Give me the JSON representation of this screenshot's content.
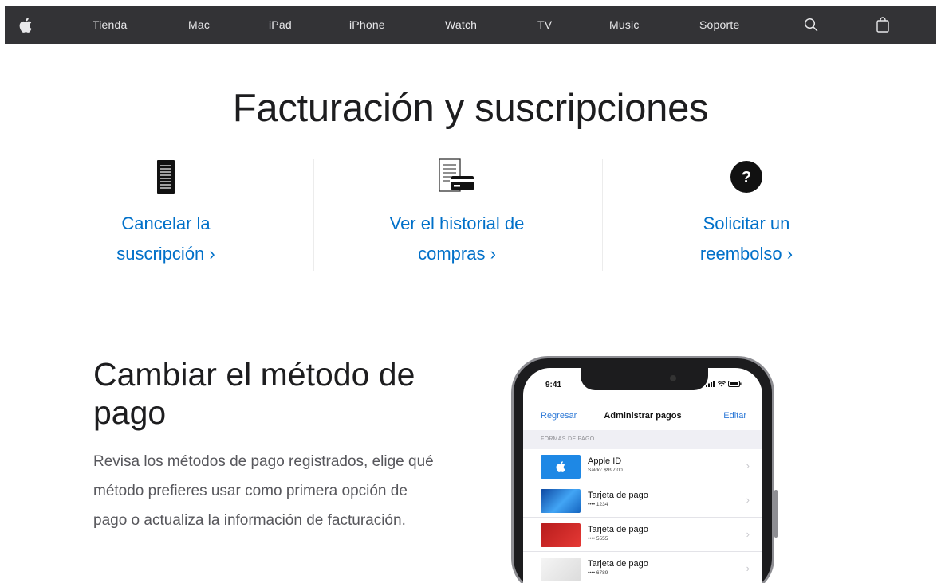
{
  "nav": {
    "items": [
      "Tienda",
      "Mac",
      "iPad",
      "iPhone",
      "Watch",
      "TV",
      "Music",
      "Soporte"
    ],
    "icons": [
      "apple-logo",
      "search-icon",
      "bag-icon"
    ]
  },
  "hero": {
    "title": "Facturación y suscripciones"
  },
  "links": [
    {
      "line1": "Cancelar la",
      "line2": "suscripción ›",
      "icon": "document-icon"
    },
    {
      "line1": "Ver el historial de",
      "line2": "compras ›",
      "icon": "receipt-card-icon"
    },
    {
      "line1": "Solicitar un",
      "line2": "reembolso ›",
      "icon": "question-circle-icon"
    }
  ],
  "section": {
    "title": "Cambiar el método de pago",
    "body": "Revisa los métodos de pago registrados, elige qué método prefieres usar como primera opción de pago o actualiza la información de facturación."
  },
  "phone": {
    "time": "9:41",
    "back": "Regresar",
    "title": "Administrar pagos",
    "edit": "Editar",
    "group_header": "FORMAS DE PAGO",
    "rows": [
      {
        "title": "Apple ID",
        "sub": "Saldo: $997.00",
        "color": "#1e88e5"
      },
      {
        "title": "Tarjeta de pago",
        "sub": "•••• 1234",
        "color": "#1565c0"
      },
      {
        "title": "Tarjeta de pago",
        "sub": "•••• 5555",
        "color": "#d32f2f"
      },
      {
        "title": "Tarjeta de pago",
        "sub": "•••• 6789",
        "color": "#e0e0e0"
      }
    ]
  },
  "colors": {
    "nav_bg": "#333336",
    "link": "#0070c9",
    "text": "#1d1d1f"
  }
}
